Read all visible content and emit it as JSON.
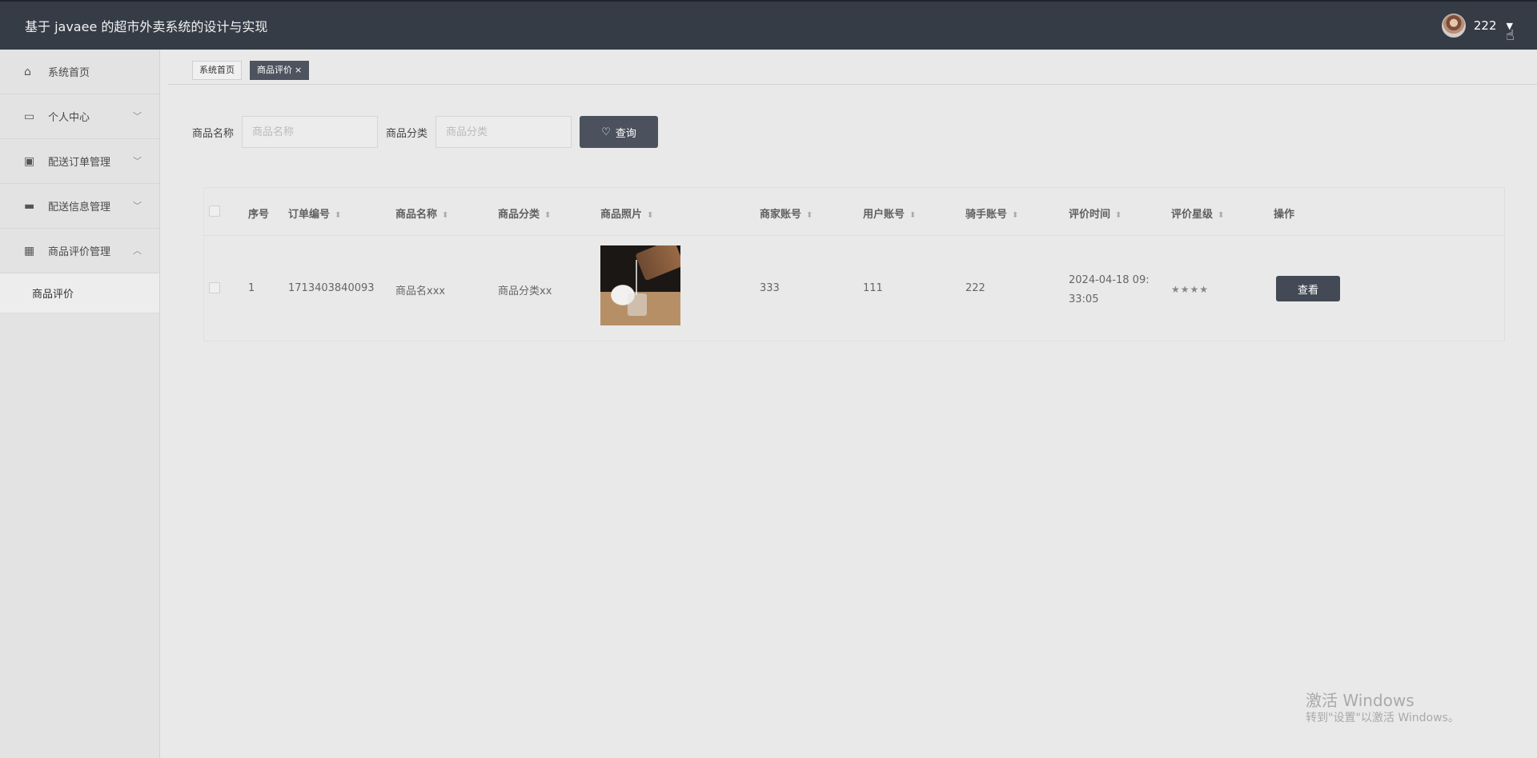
{
  "header": {
    "title": "基于 javaee 的超市外卖系统的设计与实现",
    "username": "222"
  },
  "sidebar": {
    "items": [
      {
        "label": "系统首页",
        "icon": "home-icon"
      },
      {
        "label": "个人中心",
        "icon": "calendar-icon"
      },
      {
        "label": "配送订单管理",
        "icon": "clipboard-icon"
      },
      {
        "label": "配送信息管理",
        "icon": "printer-icon"
      },
      {
        "label": "商品评价管理",
        "icon": "grid-icon"
      }
    ],
    "submenu": [
      "商品评价"
    ]
  },
  "tabs": [
    {
      "label": "系统首页"
    },
    {
      "label": "商品评价",
      "close": "×"
    }
  ],
  "search": {
    "name_label": "商品名称",
    "name_placeholder": "商品名称",
    "category_label": "商品分类",
    "category_placeholder": "商品分类",
    "button_label": "查询"
  },
  "table": {
    "headers": [
      "序号",
      "订单编号",
      "商品名称",
      "商品分类",
      "商品照片",
      "商家账号",
      "用户账号",
      "骑手账号",
      "评价时间",
      "评价星级",
      "操作"
    ],
    "rows": [
      {
        "index": "1",
        "order_no": "1713403840093",
        "name": "商品名xxx",
        "category": "商品分类xx",
        "merchant": "333",
        "user": "111",
        "rider": "222",
        "time_line1": "2024-04-18 09:",
        "time_line2": "33:05",
        "stars": "★★★★",
        "action": "查看"
      }
    ]
  },
  "watermark": {
    "line1": "激活 Windows",
    "line2": "转到\"设置\"以激活 Windows。"
  },
  "colors": {
    "header_bg": "#353c46",
    "accent_button": "#4b525d",
    "active_tab": "#4d545f"
  }
}
